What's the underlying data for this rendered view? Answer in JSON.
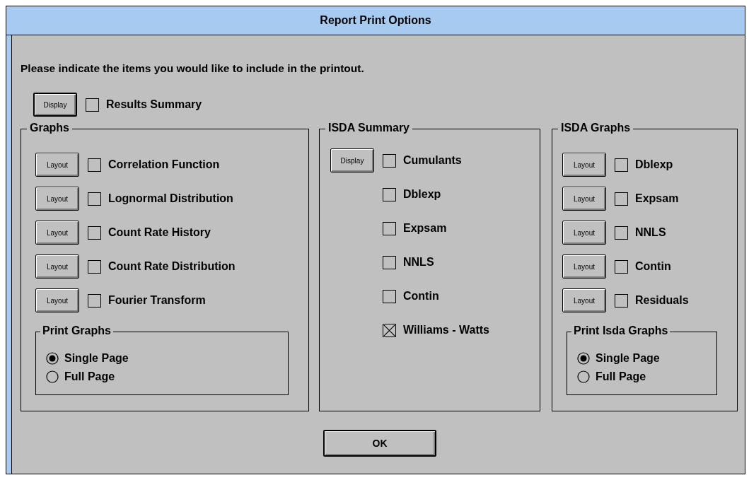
{
  "window": {
    "title": "Report Print Options"
  },
  "instruction": "Please indicate the items you would like to include in the printout.",
  "top_item": {
    "button": "Display",
    "label": "Results Summary",
    "checked": false
  },
  "groups": [
    {
      "title": "Graphs",
      "items": [
        {
          "button": "Layout",
          "label": "Correlation Function",
          "checked": false
        },
        {
          "button": "Layout",
          "label": "Lognormal Distribution",
          "checked": false
        },
        {
          "button": "Layout",
          "label": "Count Rate History",
          "checked": false
        },
        {
          "button": "Layout",
          "label": "Count Rate Distribution",
          "checked": false
        },
        {
          "button": "Layout",
          "label": "Fourier Transform",
          "checked": false
        }
      ],
      "radio_group": {
        "title": "Print Graphs",
        "options": [
          {
            "label": "Single Page",
            "selected": true
          },
          {
            "label": "Full Page",
            "selected": false
          }
        ]
      }
    },
    {
      "title": "ISDA Summary",
      "items": [
        {
          "button": "Display",
          "label": "Cumulants",
          "checked": false
        },
        {
          "label": "Dblexp",
          "checked": false
        },
        {
          "label": "Expsam",
          "checked": false
        },
        {
          "label": "NNLS",
          "checked": false
        },
        {
          "label": "Contin",
          "checked": false
        },
        {
          "label": "Williams - Watts",
          "checked": true
        }
      ]
    },
    {
      "title": "ISDA Graphs",
      "items": [
        {
          "button": "Layout",
          "label": "Dblexp",
          "checked": false
        },
        {
          "button": "Layout",
          "label": "Expsam",
          "checked": false
        },
        {
          "button": "Layout",
          "label": "NNLS",
          "checked": false
        },
        {
          "button": "Layout",
          "label": "Contin",
          "checked": false
        },
        {
          "button": "Layout",
          "label": "Residuals",
          "checked": false
        }
      ],
      "radio_group": {
        "title": "Print Isda Graphs",
        "options": [
          {
            "label": "Single Page",
            "selected": true
          },
          {
            "label": "Full Page",
            "selected": false
          }
        ]
      }
    }
  ],
  "ok_button": "OK"
}
